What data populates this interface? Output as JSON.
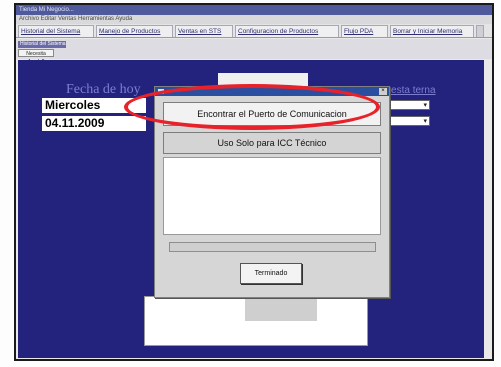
{
  "window": {
    "title_bar_text": "Tienda Mi Negocio...",
    "menu_text": "Archivo  Editar  Ventas  Herramientas  Ayuda"
  },
  "tabs": [
    {
      "label": "Historial del Sistema"
    },
    {
      "label": "Manejo de Productos"
    },
    {
      "label": "Ventas en STS"
    },
    {
      "label": "Configuracion de Productos"
    },
    {
      "label": "Flujo PDA"
    },
    {
      "label": "Borrar y Iniciar Memoria"
    }
  ],
  "subtab": {
    "label": "Historial del Sistema",
    "help_button": "Necesita Ayuda?"
  },
  "main": {
    "fecha_label": "Fecha de hoy",
    "day_value": "Miercoles",
    "date_value": "04.11.2009",
    "right_link": "...en para esta terna"
  },
  "dialog": {
    "title": "",
    "encontrar_button": "Encontrar el Puerto de Comunicacion",
    "uso_button": "Uso Solo para ICC Técnico",
    "log_text": "",
    "progress_fraction": 0,
    "terminado_button": "Terminado"
  },
  "colors": {
    "main_bg": "#23237e",
    "dialog_title": "#2a4fa0",
    "highlight_ellipse": "#e8222a"
  },
  "icons": {
    "dialog_app": "app-icon",
    "dialog_close": "close-icon",
    "combo_arrow": "chevron-down-icon"
  }
}
